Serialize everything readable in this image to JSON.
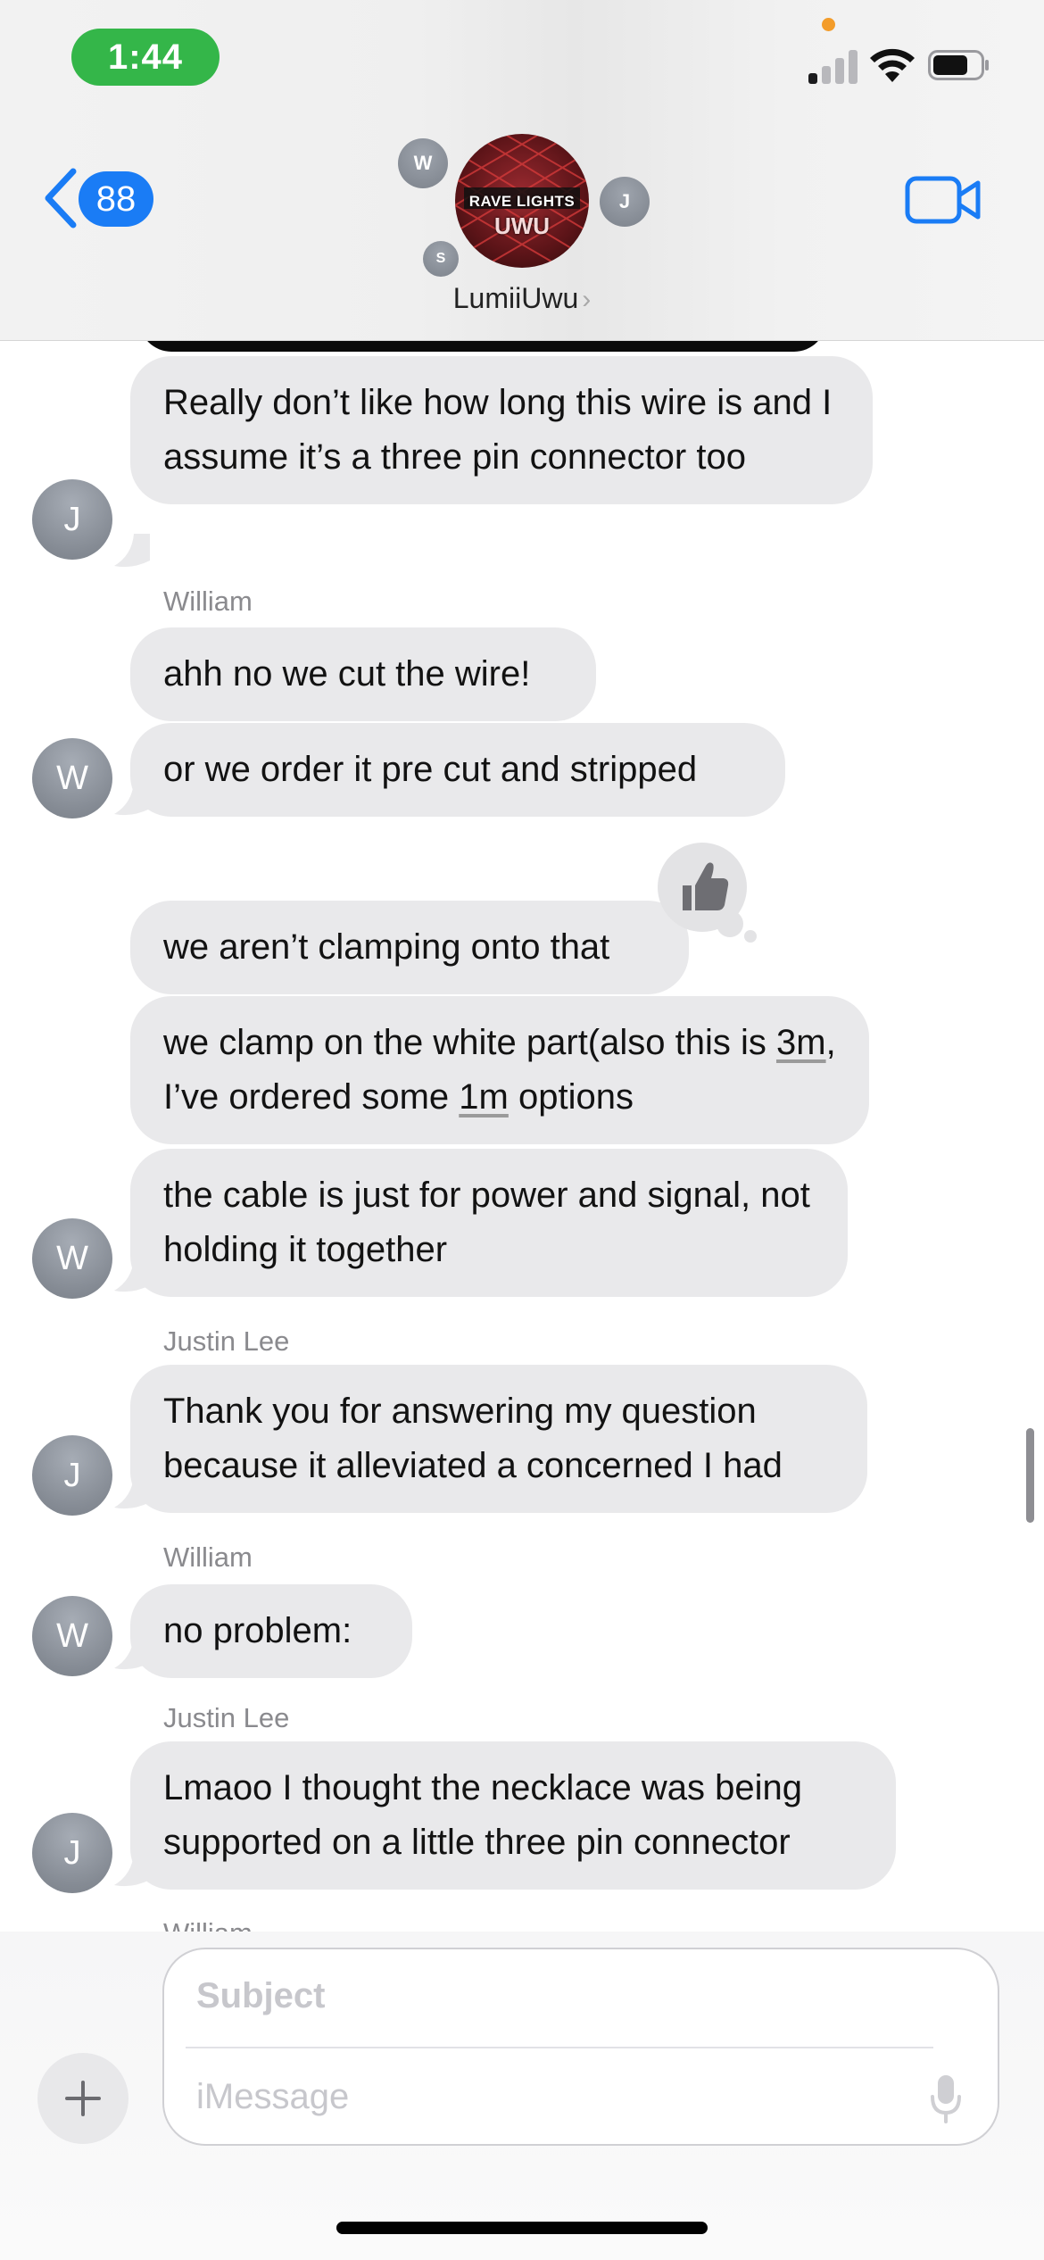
{
  "status_bar": {
    "time": "1:44",
    "time_pill_color": "#34b649",
    "privacy_dot_color": "#f39c2a",
    "signal_icon": "cellular-signal-icon",
    "wifi_icon": "wifi-icon",
    "battery_icon": "battery-icon"
  },
  "header": {
    "back_count": "88",
    "group_name": "LumiiUwu",
    "group_name_chevron": "›",
    "group_avatar": {
      "line1": "RAVE LIGHTS",
      "line2": "UWU"
    },
    "member_avatars": [
      {
        "initial": "W"
      },
      {
        "initial": "J"
      },
      {
        "initial": "S"
      }
    ],
    "accent_color": "#1a7cf5"
  },
  "messages": [
    {
      "text": "Really don’t like how long this wire is and I assume it’s a three pin connector too",
      "avatar": "J"
    },
    {
      "sender": "William",
      "text": "ahh no we cut the wire!"
    },
    {
      "text": "or we order it pre cut and stripped",
      "avatar": "W"
    },
    {
      "text": "we aren’t clamping onto that",
      "tapback": "thumbs-up-icon"
    },
    {
      "text_parts": [
        "we clamp on the white part(also this is ",
        "3m",
        ", I’ve ordered some ",
        "1m",
        " options"
      ]
    },
    {
      "text": "the cable is just for power and signal, not holding it together",
      "avatar": "W"
    },
    {
      "sender": "Justin Lee",
      "text": "Thank you for answering my question because it alleviated a concerned I had",
      "avatar": "J"
    },
    {
      "sender": "William",
      "text": "no problem:",
      "avatar": "W"
    },
    {
      "sender": "Justin Lee",
      "text": "Lmaoo I thought the necklace was being supported on a little three pin connector",
      "avatar": "J"
    },
    {
      "sender": "William"
    }
  ],
  "composer": {
    "subject_placeholder": "Subject",
    "message_placeholder": "iMessage",
    "plus_icon": "plus-icon",
    "mic_icon": "microphone-icon"
  },
  "colors": {
    "incoming_bubble": "#e9e9eb",
    "avatar_gray": "#858b94"
  }
}
